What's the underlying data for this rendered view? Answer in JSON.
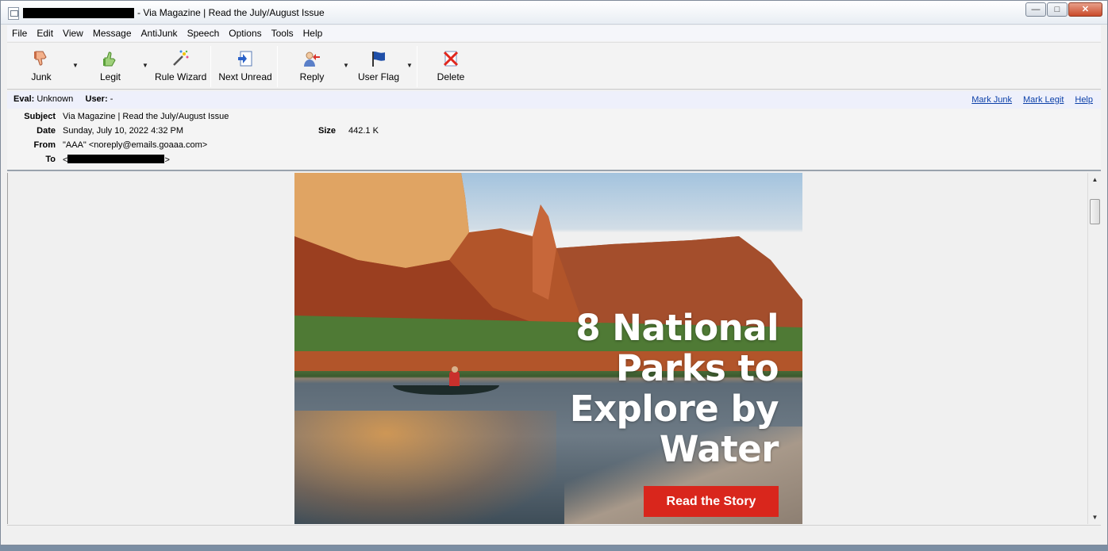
{
  "window": {
    "title": "- Via Magazine | Read the July/August Issue",
    "controls": {
      "minimize": "—",
      "maximize": "□",
      "close": "✕"
    }
  },
  "menu": [
    "File",
    "Edit",
    "View",
    "Message",
    "AntiJunk",
    "Speech",
    "Options",
    "Tools",
    "Help"
  ],
  "toolbar": {
    "junk": "Junk",
    "legit": "Legit",
    "rule_wizard": "Rule Wizard",
    "next_unread": "Next Unread",
    "reply": "Reply",
    "user_flag": "User Flag",
    "delete": "Delete",
    "dropdown_glyph": "▼"
  },
  "eval": {
    "eval_label": "Eval:",
    "eval_value": "Unknown",
    "user_label": "User:",
    "user_value": "-",
    "mark_junk": "Mark Junk",
    "mark_legit": "Mark Legit",
    "help": "Help"
  },
  "headers": {
    "subject_label": "Subject",
    "subject": "Via Magazine | Read the July/August Issue",
    "date_label": "Date",
    "date": "Sunday, July 10, 2022 4:32 PM",
    "size_label": "Size",
    "size": "442.1 K",
    "from_label": "From",
    "from": "\"AAA\" <noreply@emails.goaaa.com>",
    "to_label": "To",
    "to_open": "<",
    "to_close": ">"
  },
  "hero": {
    "headline": [
      "8 National",
      "Parks to",
      "Explore by",
      "Water"
    ],
    "cta": "Read the Story"
  },
  "colors": {
    "cta": "#d9261c",
    "link": "#0b3fa8",
    "eval_bar": "#eef0fb"
  }
}
